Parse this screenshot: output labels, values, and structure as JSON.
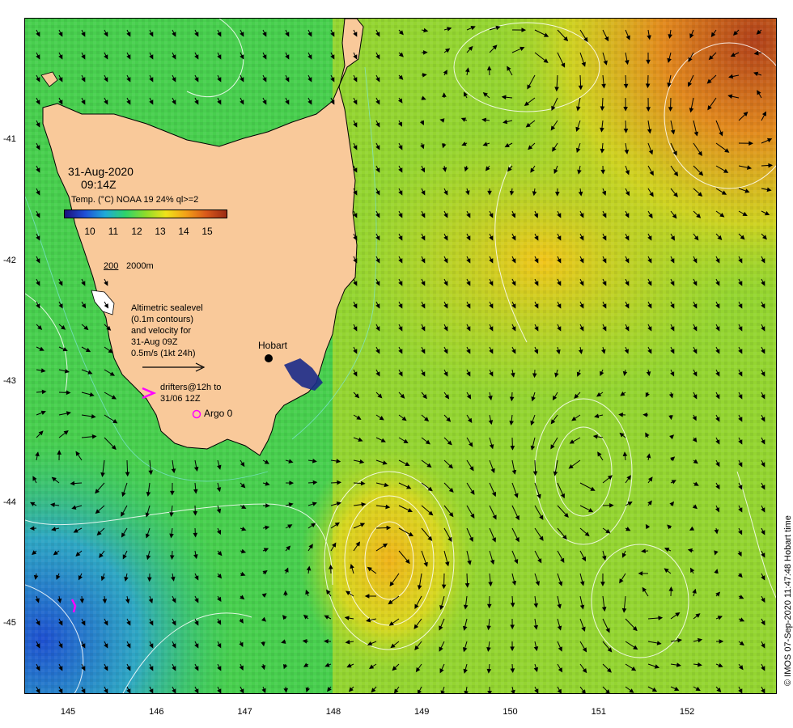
{
  "overlay": {
    "date": "31-Aug-2020",
    "time": "09:14Z",
    "sensor": "Temp. (°C) NOAA 19 24% ql>=2",
    "colorbar_ticks": [
      "10",
      "11",
      "12",
      "13",
      "14",
      "15"
    ],
    "colorbar_colors": [
      "#1a0f7a",
      "#1f4fd6",
      "#1faad8",
      "#2fd36a",
      "#8fdc2a",
      "#f0e21a",
      "#f3a018",
      "#d9581a",
      "#9a2a14"
    ],
    "isobath_label_200": "200",
    "isobath_label_2000": "2000m",
    "altimetry_lines": [
      "Altimetric sealevel",
      "(0.1m contours)",
      "and velocity for",
      "31-Aug 09Z",
      "0.5m/s (1kt 24h)"
    ],
    "drifters_line1": "drifters@12h to",
    "drifters_line2": "31/06 12Z",
    "argo": "Argo 0",
    "hobart": "Hobart"
  },
  "axes": {
    "x_ticks": [
      "145",
      "146",
      "147",
      "148",
      "149",
      "150",
      "151",
      "152"
    ],
    "y_ticks": [
      "-41",
      "-42",
      "-43",
      "-44",
      "-45"
    ]
  },
  "credit": "© IMOS 07-Sep-2020 11:47:48 Hobart time",
  "colors": {
    "land": "#f9c99a",
    "cold": "#1f6fe0",
    "warm": "#e07a18",
    "sea_mid": "#3fcf55",
    "contour": "#ffffff",
    "arrow": "#000000",
    "drifter": "#ff00ff"
  }
}
